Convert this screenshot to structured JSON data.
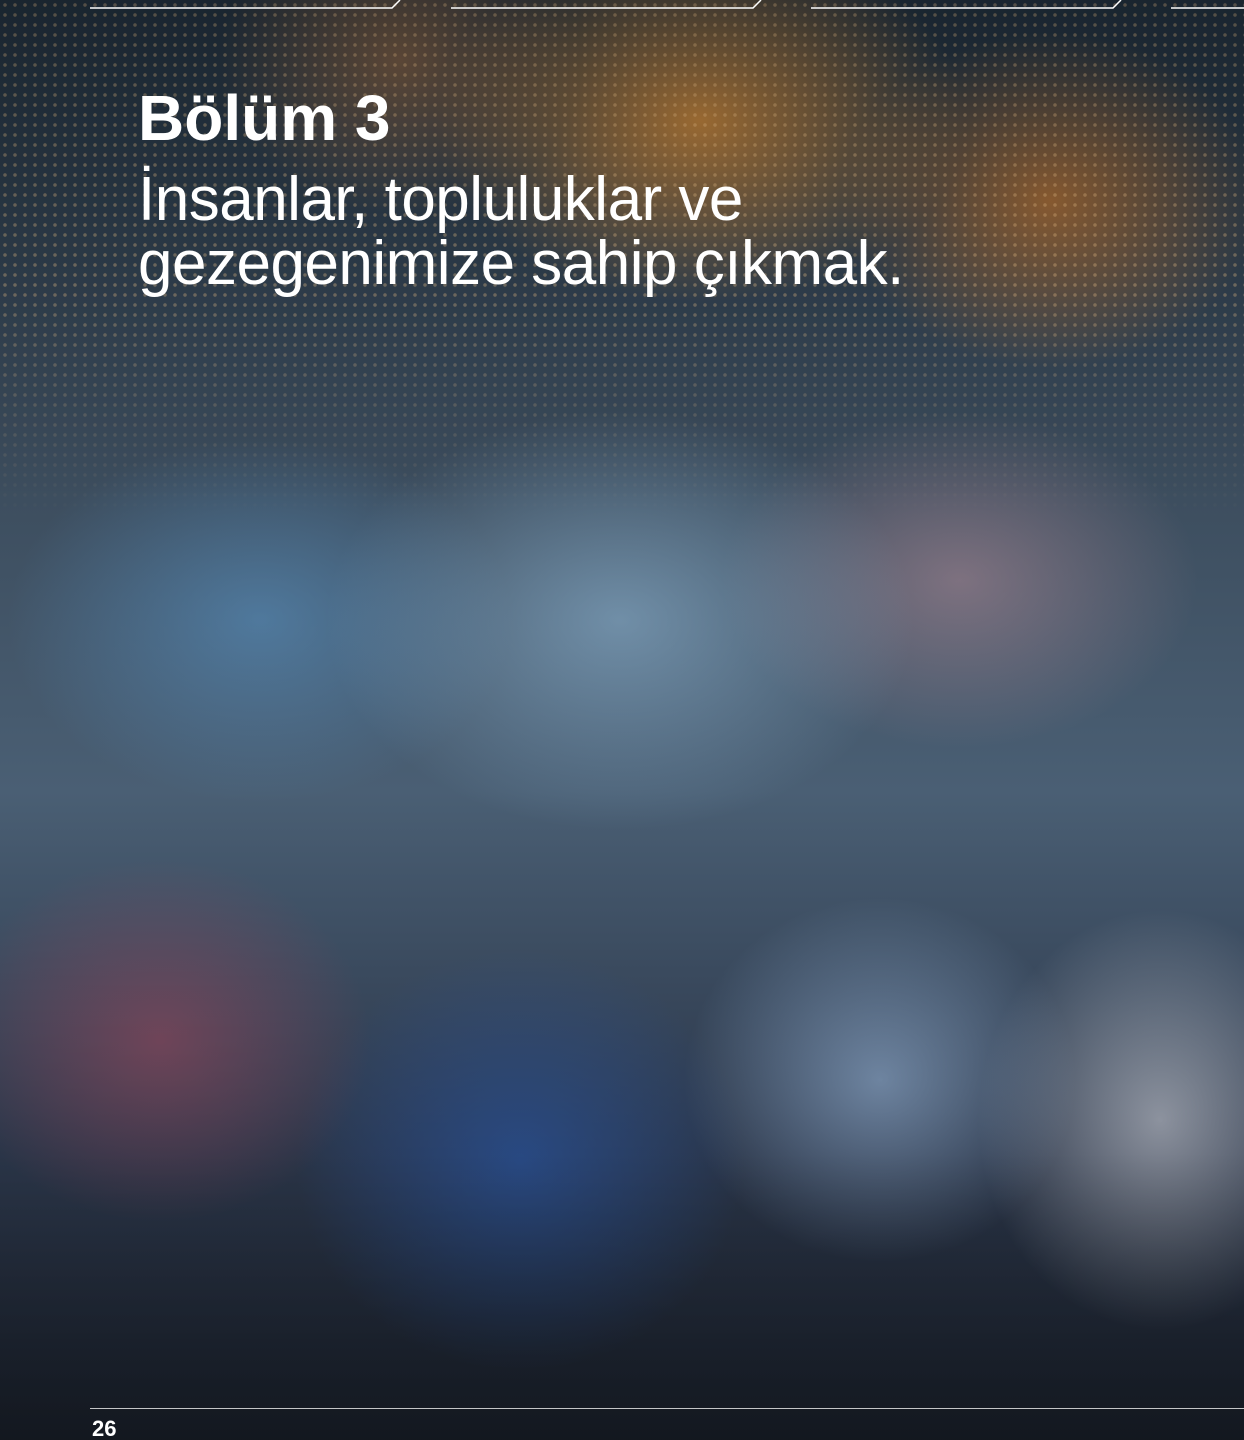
{
  "heading": {
    "chapter": "Bölüm 3",
    "subtitle_line1": "İnsanlar, topluluklar ve",
    "subtitle_line2": "gezegenimize sahip çıkmak."
  },
  "footer": {
    "page_number": "26"
  },
  "colors": {
    "text": "#ffffff",
    "rule": "#ffffff"
  }
}
